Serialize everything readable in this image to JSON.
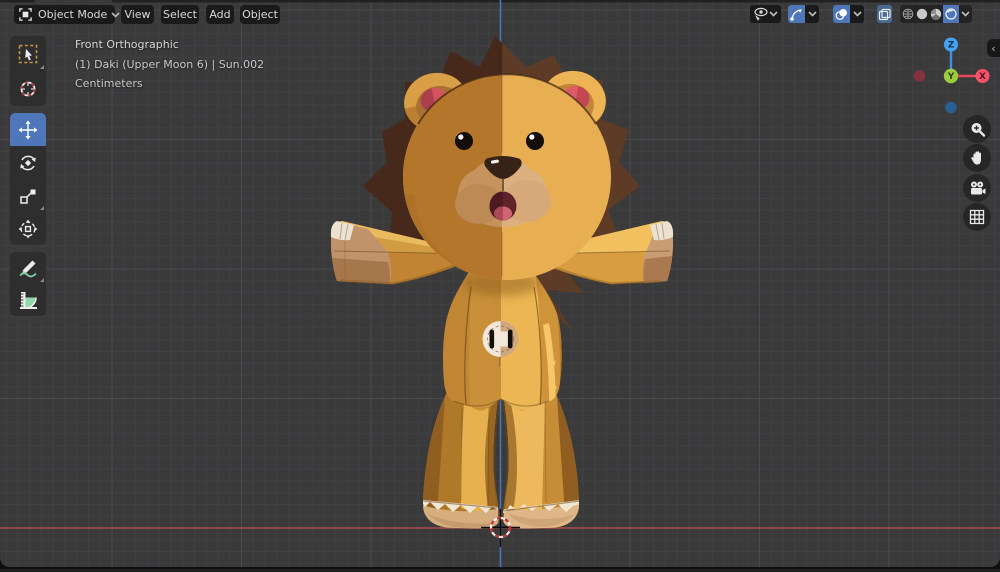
{
  "app": "blender-3d-viewport",
  "header": {
    "mode_selector": {
      "label": "Object Mode",
      "icon": "object-mode-icon"
    },
    "menus": [
      {
        "label": "View"
      },
      {
        "label": "Select"
      },
      {
        "label": "Add"
      },
      {
        "label": "Object"
      }
    ],
    "right_controls": {
      "visibility_dropdown": "selectability-visibility",
      "gizmos_toggle": "show-gizmos",
      "overlays_toggle": "show-overlays",
      "xray_toggle": "toggle-xray",
      "shading_modes": [
        "wireframe",
        "solid",
        "material-preview",
        "rendered"
      ],
      "active_shading": "rendered"
    }
  },
  "toolbar": {
    "tools": [
      {
        "name": "select-box",
        "active": false,
        "has_submenu": true
      },
      {
        "name": "cursor",
        "active": false,
        "has_submenu": false
      },
      {
        "name": "move",
        "active": true,
        "has_submenu": false
      },
      {
        "name": "rotate",
        "active": false,
        "has_submenu": false
      },
      {
        "name": "scale",
        "active": false,
        "has_submenu": true
      },
      {
        "name": "transform",
        "active": false,
        "has_submenu": false
      },
      {
        "name": "annotate",
        "active": false,
        "has_submenu": true
      },
      {
        "name": "measure",
        "active": false,
        "has_submenu": false
      }
    ]
  },
  "viewport": {
    "overlay_text": {
      "view_name": "Front Orthographic",
      "active_object": "(1) Daki (Upper Moon 6) | Sun.002",
      "units": "Centimeters"
    },
    "gizmo_axes": {
      "z": "Z",
      "y": "Y",
      "x": "X"
    },
    "sidebar_toggle": "‹",
    "nav_buttons": [
      "zoom",
      "pan",
      "camera-view",
      "toggle-orthographic"
    ],
    "scene_object": "lion-plush-toy"
  },
  "colors": {
    "accent_blue": "#4f76b8",
    "viewport_bg": "#3a3a3b",
    "grid_minor": "#424244",
    "grid_major": "#4a4a4c",
    "axis_x_red": "#a84c4c",
    "axis_z_blue": "#4b76b5",
    "gizmo_x": "#f4536a",
    "gizmo_y": "#9bcd3d",
    "gizmo_z": "#46a3f2",
    "plush_dark_gold": "#ba7c2e",
    "plush_light_gold": "#e8ae52",
    "plush_mane_dark": "#47291b",
    "plush_mane_light": "#5e3b26"
  }
}
